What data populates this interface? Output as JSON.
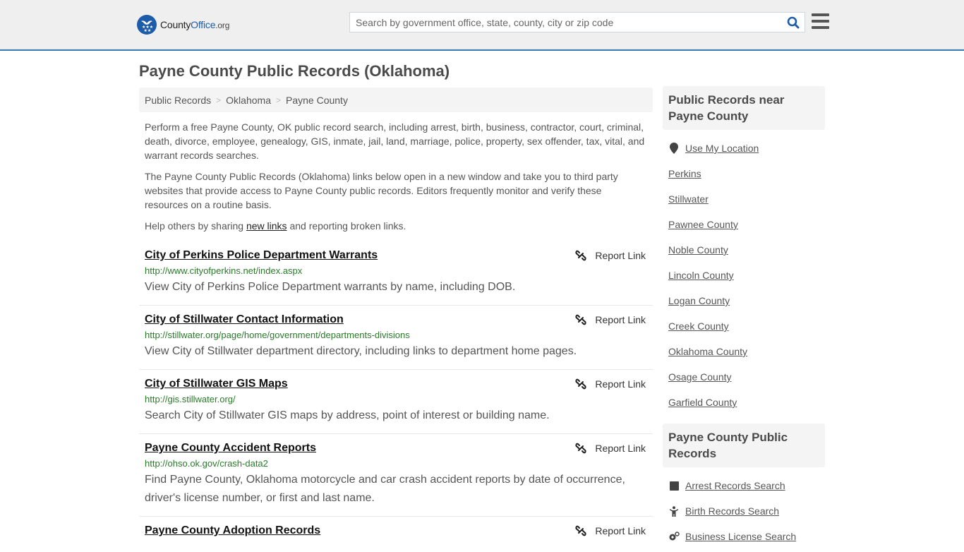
{
  "header": {
    "logo": {
      "prefix": "County",
      "brand": "Office",
      "tld": ".org"
    },
    "search": {
      "placeholder": "Search by government office, state, county, city or zip code",
      "value": ""
    },
    "colors": {
      "accent": "#1c5ca8",
      "bar": "#3c7dae",
      "header_bg": "#efefef"
    }
  },
  "page": {
    "title": "Payne County Public Records (Oklahoma)"
  },
  "breadcrumb": [
    {
      "label": "Public Records"
    },
    {
      "label": "Oklahoma"
    },
    {
      "label": "Payne County"
    }
  ],
  "intro": {
    "p1": "Perform a free Payne County, OK public record search, including arrest, birth, business, contractor, court, criminal, death, divorce, employee, genealogy, GIS, inmate, jail, land, marriage, police, property, sex offender, tax, vital, and warrant records searches.",
    "p2": "The Payne County Public Records (Oklahoma) links below open in a new window and take you to third party websites that provide access to Payne County public records. Editors frequently monitor and verify these resources on a routine basis.",
    "p3_before": "Help others by sharing ",
    "p3_link": "new links",
    "p3_after": " and reporting broken links."
  },
  "report_label": "Report Link",
  "results": [
    {
      "title": "City of Perkins Police Department Warrants",
      "url": "http://www.cityofperkins.net/index.aspx",
      "desc": "View City of Perkins Police Department warrants by name, including DOB."
    },
    {
      "title": "City of Stillwater Contact Information",
      "url": "http://stillwater.org/page/home/government/departments-divisions",
      "desc": "View City of Stillwater department directory, including links to department home pages."
    },
    {
      "title": "City of Stillwater GIS Maps",
      "url": "http://gis.stillwater.org/",
      "desc": "Search City of Stillwater GIS maps by address, point of interest or building name."
    },
    {
      "title": "Payne County Accident Reports",
      "url": "http://ohso.ok.gov/crash-data2",
      "desc": "Find Payne County, Oklahoma motorcycle and car crash accident reports by date of occurrence, driver's license number, or first and last name."
    },
    {
      "title": "Payne County Adoption Records",
      "url": "",
      "desc": ""
    }
  ],
  "sidebar": {
    "nearby": {
      "heading": "Public Records near Payne County",
      "use_location": "Use My Location",
      "items": [
        "Perkins",
        "Stillwater",
        "Pawnee County",
        "Noble County",
        "Lincoln County",
        "Logan County",
        "Creek County",
        "Oklahoma County",
        "Osage County",
        "Garfield County"
      ]
    },
    "county_records": {
      "heading": "Payne County Public Records",
      "items": [
        {
          "label": "Arrest Records Search",
          "icon": "square-icon"
        },
        {
          "label": "Birth Records Search",
          "icon": "child-icon"
        },
        {
          "label": "Business License Search",
          "icon": "business-gears-icon"
        }
      ]
    }
  }
}
